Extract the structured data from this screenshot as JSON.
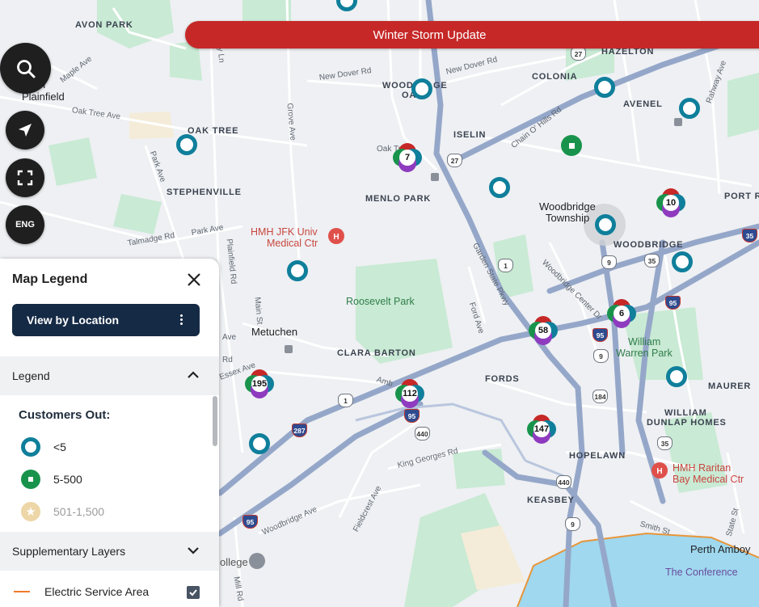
{
  "banner": {
    "text": "Winter Storm Update"
  },
  "controls": {
    "search": "search-icon",
    "locate": "navigation-arrow-icon",
    "fullscreen": "fullscreen-icon",
    "language": "ENG"
  },
  "map": {
    "places": {
      "avon_park": "AVON PARK",
      "south_plainfield_1": "uth",
      "south_plainfield_2": "Plainfield",
      "oak_tree": "OAK TREE",
      "stephenville": "STEPHENVILLE",
      "woodbridge_oaks_1": "WOODB",
      "woodbridge_oaks_2": "GE",
      "woodbridge_oaks_3": "OA",
      "colonia": "COLONIA",
      "hazelton": "HAZELTON",
      "avenel": "AVENEL",
      "iselin": "ISELIN",
      "menlo_park": "MENLO PARK",
      "woodbridge_twp_1": "Woodbridge",
      "woodbridge_twp_2": "Township",
      "woodbridge": "WOODBRIDGE",
      "port_r": "PORT R",
      "metuchen": "Metuchen",
      "clara_barton": "CLARA BARTON",
      "fords": "FORDS",
      "maurer": "MAURER",
      "william_dunlap_1": "WILLIAM",
      "william_dunlap_2": "DUNLAP HOMES",
      "hopelawn": "HOPELAWN",
      "keasbey": "KEASBEY",
      "perth_amboy": "Perth Amboy",
      "roosevelt_park": "Roosevelt Park",
      "william_warren_1": "William",
      "william_warren_2": "Warren Park",
      "hmh_jfk_1": "HMH JFK Univ",
      "hmh_jfk_2": "Medical Ctr",
      "hmh_raritan_1": "HMH Raritan",
      "hmh_raritan_2": "Bay Medical Ctr",
      "conference": "The Conference",
      "college": "ollege"
    },
    "streets": {
      "maple": "Maple Ave",
      "oak_tree_ave": "Oak Tree Ave",
      "park_ave": "Park Ave",
      "talmadge": "Talmadge Rd",
      "park_ave2": "Park Ave",
      "plainfield": "Plainfield Rd",
      "new_dover": "New Dover Rd",
      "new_dover2": "New Dover Rd",
      "grove": "Grove Ave",
      "oak_tree_rd": "Oak Tr",
      "chain_o_hills": "Chain O' Hills Rd",
      "rahway": "Rahway Ave",
      "garden_state": "Garden State Pkwy",
      "woodbridge_center": "Woodbridge Center Dr",
      "ford": "Ford Ave",
      "main": "Main St",
      "essex": "Essex Ave",
      "king_georges": "King Georges Rd",
      "fieldcrest": "Fieldcrest Ave",
      "woodbridge_ave": "Woodbridge Ave",
      "smith": "Smith St",
      "state_st": "State St",
      "mill": "Mill Rd",
      "ambo": "Amb",
      "ave": "Ave",
      "rd": "Rd",
      "gley": "gley Ln"
    },
    "shields": [
      "27",
      "27",
      "1",
      "35",
      "9",
      "35",
      "95",
      "9",
      "95",
      "184",
      "1",
      "440",
      "287",
      "35",
      "440",
      "95",
      "95",
      "9",
      "35"
    ]
  },
  "outage_markers": {
    "clusters": [
      "7",
      "10",
      "6",
      "58",
      "195",
      "112",
      "147"
    ],
    "marker_colors": {
      "low": "#0f7f9b",
      "mid": "#19934c",
      "high": "#c62828",
      "purple": "#8e3bbf"
    }
  },
  "legend": {
    "title": "Map Legend",
    "view_button": "View by Location",
    "legend_section": "Legend",
    "customers_out": "Customers Out:",
    "items": [
      {
        "label": "<5",
        "icon": "ring-icon"
      },
      {
        "label": "5-500",
        "icon": "square-icon"
      },
      {
        "label": "501-1,500",
        "icon": "star-icon"
      }
    ],
    "supplementary": "Supplementary Layers",
    "layers": [
      {
        "label": "Electric Service Area",
        "checked": true
      }
    ]
  }
}
